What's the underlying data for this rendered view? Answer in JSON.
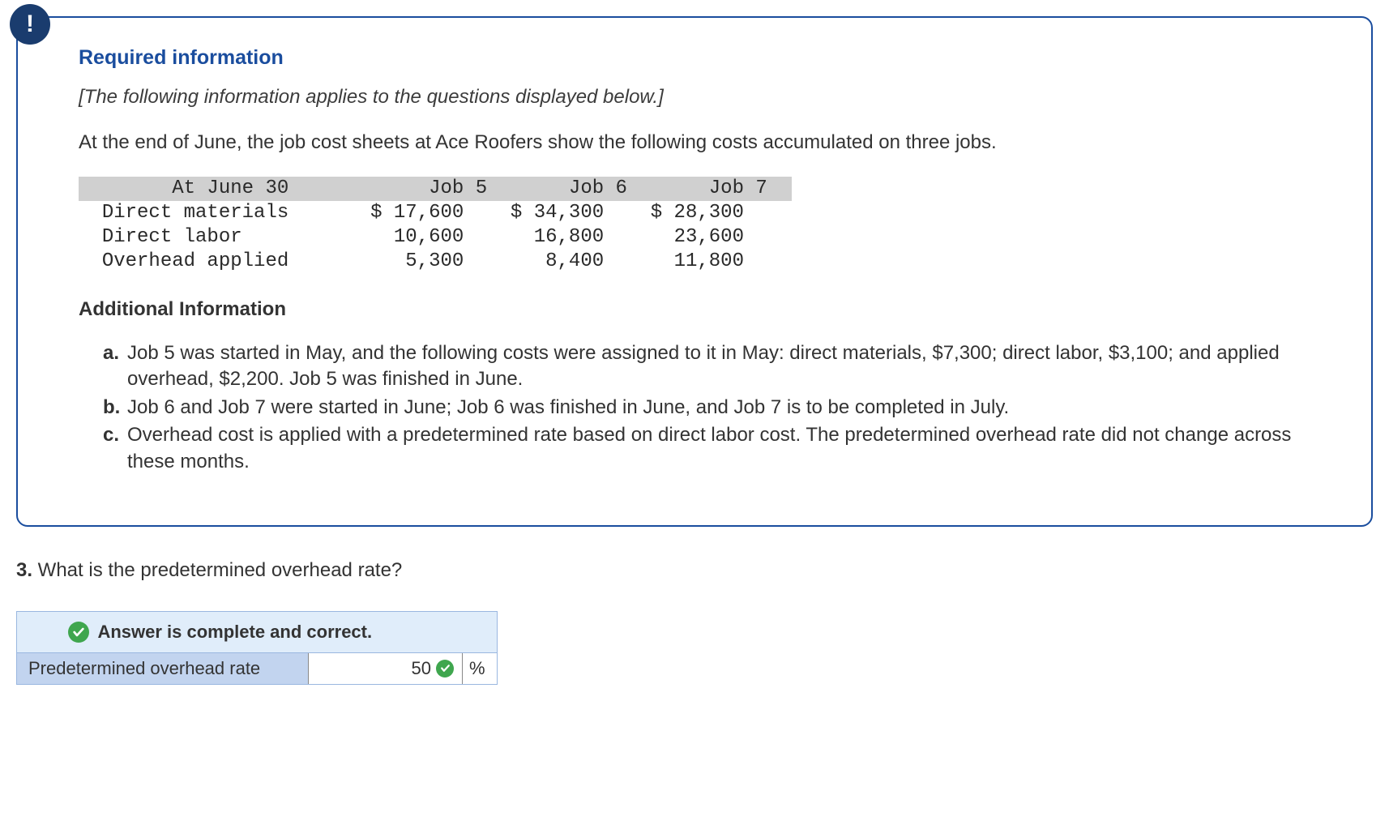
{
  "badge_symbol": "!",
  "required_title": "Required information",
  "subtitle": "[The following information applies to the questions displayed below.]",
  "intro": "At the end of June, the job cost sheets at Ace Roofers show the following costs accumulated on three jobs.",
  "table": {
    "header_date": "At June 30",
    "col1": "Job 5",
    "col2": "Job 6",
    "col3": "Job 7",
    "rows": [
      {
        "label": "Direct materials",
        "v1": "$ 17,600",
        "v2": "$ 34,300",
        "v3": "$ 28,300"
      },
      {
        "label": "Direct labor",
        "v1": "10,600",
        "v2": "16,800",
        "v3": "23,600"
      },
      {
        "label": "Overhead applied",
        "v1": "5,300",
        "v2": "8,400",
        "v3": "11,800"
      }
    ]
  },
  "additional_title": "Additional Information",
  "info_items": [
    {
      "marker": "a.",
      "text": "Job 5 was started in May, and the following costs were assigned to it in May: direct materials, $7,300; direct labor, $3,100; and applied overhead, $2,200. Job 5 was finished in June."
    },
    {
      "marker": "b.",
      "text": "Job 6 and Job 7 were started in June; Job 6 was finished in June, and Job 7 is to be completed in July."
    },
    {
      "marker": "c.",
      "text": "Overhead cost is applied with a predetermined rate based on direct labor cost. The predetermined overhead rate did not change across these months."
    }
  ],
  "question": {
    "number": "3.",
    "text": " What is the predetermined overhead rate?"
  },
  "answer": {
    "header": "Answer is complete and correct.",
    "label": "Predetermined overhead rate",
    "value": "50",
    "unit": "%"
  }
}
